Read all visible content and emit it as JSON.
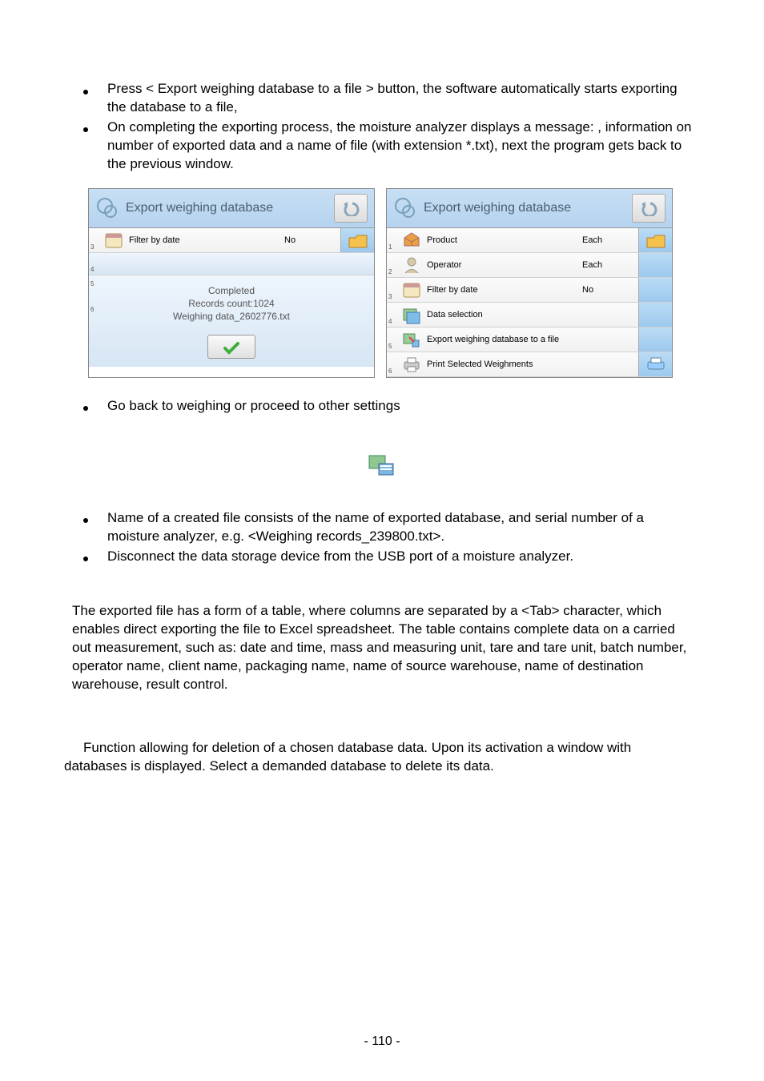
{
  "bullets_top": [
    "Press < Export weighing database to a file > button, the software automatically starts exporting the database to a file,",
    "On completing the exporting process, the moisture analyzer displays a message:                                                     , information on number of exported data and a name of file (with extension *.txt), next the program gets back to the previous window."
  ],
  "screenshot_left": {
    "title": "Export weighing database",
    "rows": [
      {
        "num": "3",
        "label": "Filter by date",
        "value": "No",
        "icon": "date"
      }
    ],
    "dialog": {
      "line1": "Completed",
      "line2": "Records count:1024",
      "line3": "Weighing data_2602776.txt"
    },
    "empty_nums": [
      "4",
      "5",
      "6"
    ]
  },
  "screenshot_right": {
    "title": "Export weighing database",
    "rows": [
      {
        "num": "1",
        "label": "Product",
        "value": "Each",
        "icon": "product",
        "side": "folder"
      },
      {
        "num": "2",
        "label": "Operator",
        "value": "Each",
        "icon": "operator",
        "side": "blank"
      },
      {
        "num": "3",
        "label": "Filter by date",
        "value": "No",
        "icon": "date",
        "side": "blank"
      },
      {
        "num": "4",
        "label": "Data selection",
        "value": "",
        "icon": "data",
        "side": "blank"
      },
      {
        "num": "5",
        "label": "Export weighing database to a file",
        "value": "",
        "icon": "export",
        "side": "blank"
      },
      {
        "num": "6",
        "label": "Print Selected Weighments",
        "value": "",
        "icon": "print",
        "side": "print"
      }
    ]
  },
  "bullet_mid": "Go back to weighing or proceed to other settings",
  "bullets_lower": [
    "Name of a created file consists of the name of exported database, and serial number of a moisture analyzer, e.g. <Weighing records_239800.txt>.",
    "Disconnect the data storage device from the USB port of a moisture analyzer."
  ],
  "paragraph1": "The exported file has a form of a table, where columns are separated by a <Tab> character, which enables direct exporting the file to Excel spreadsheet. The table contains complete data on a carried out measurement, such as: date and time, mass and measuring unit, tare and tare unit, batch number, operator name, client name, packaging name, name of source warehouse, name of destination warehouse, result control.",
  "paragraph2": "Function allowing for deletion of a chosen database data. Upon its activation a window with databases is displayed. Select a demanded database to delete its data.",
  "page_number": "- 110 -"
}
